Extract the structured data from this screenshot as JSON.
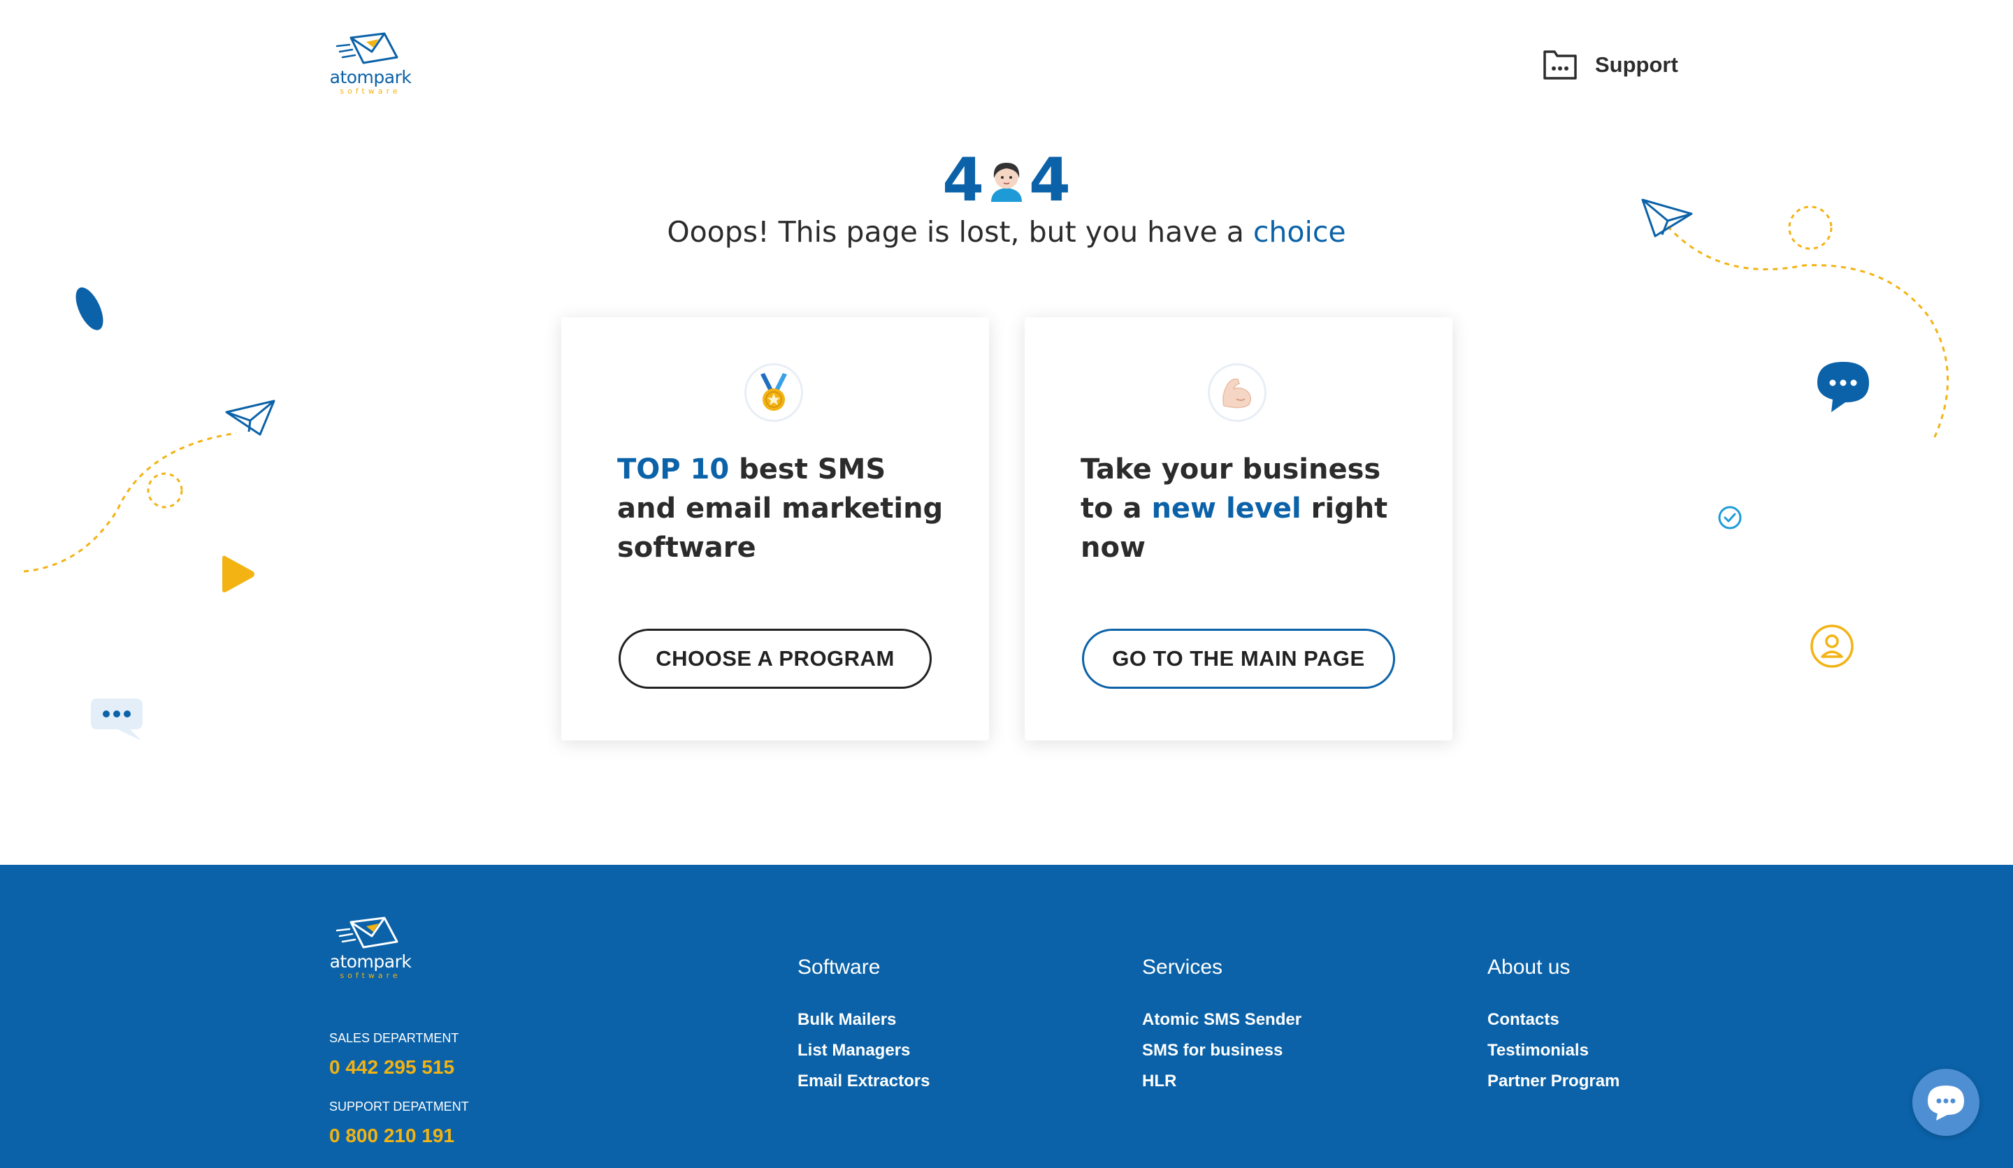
{
  "header": {
    "logo_word": "atompark",
    "logo_sub": "software",
    "support_label": "Support",
    "support_icon": "chat-window-icon"
  },
  "hero": {
    "digit_left": "4",
    "digit_right": "4",
    "face_icon": "person-face-icon",
    "subtitle_main": "Ooops! This page is lost, but you have a ",
    "subtitle_accent": "choice"
  },
  "cards": [
    {
      "icon": "medal-icon",
      "heading_highlight": "TOP 10",
      "heading_rest": " best SMS and email marketing software",
      "button_label": "CHOOSE A PROGRAM"
    },
    {
      "icon": "flexed-biceps-icon",
      "heading_pre": "Take your business to a ",
      "heading_highlight": "new level",
      "heading_post": " right now",
      "button_label": "GO TO THE MAIN PAGE"
    }
  ],
  "footer": {
    "logo_word": "atompark",
    "logo_sub": "software",
    "sales_label": "SALES DEPARTMENT",
    "sales_phone": "0 442 295 515",
    "support_label": "SUPPORT DEPATMENT",
    "support_phone": "0 800 210 191",
    "columns": [
      {
        "title": "Software",
        "links": [
          "Bulk Mailers",
          "List Managers",
          "Email Extractors"
        ]
      },
      {
        "title": "Services",
        "links": [
          "Atomic SMS Sender",
          "SMS for business",
          "HLR"
        ]
      },
      {
        "title": "About us",
        "links": [
          "Contacts",
          "Testimonials",
          "Partner Program"
        ]
      }
    ]
  },
  "colors": {
    "brand_blue": "#0b62a8",
    "accent_yellow": "#f2b313",
    "text_dark": "#2b2b2b"
  }
}
